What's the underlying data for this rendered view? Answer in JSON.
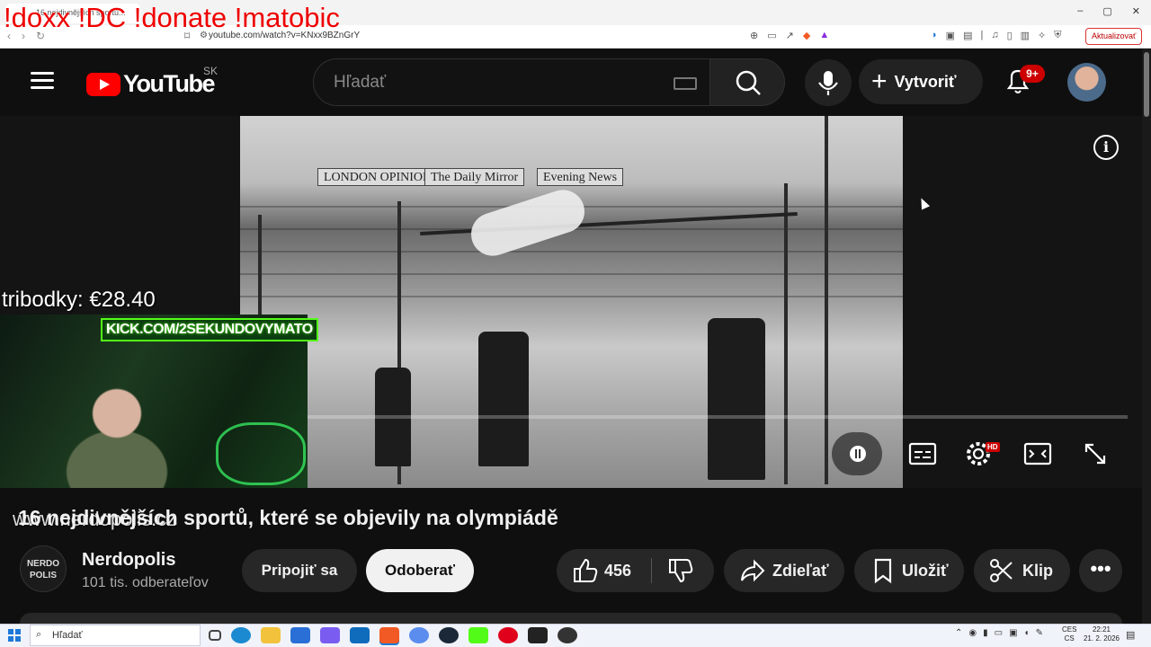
{
  "browser": {
    "tab_title": "16 nejdivnějších sportů...",
    "url": "youtube.com/watch?v=KNxx9BZnGrY",
    "update_button": "Aktualizovať",
    "window_controls": [
      "–",
      "▢",
      "✕"
    ]
  },
  "stream_overlay": {
    "commands": "!doxx !DC  !donate  !matobic",
    "donation_text": "tribodky: €28.40",
    "kick_banner": "KICK.COM/2SEKUNDOVYMATO",
    "ticker_text": "www.nerdopolis.cz"
  },
  "youtube": {
    "logo_text": "YouTube",
    "region": "SK",
    "search_placeholder": "Hľadať",
    "create_label": "Vytvoriť",
    "notification_count": "9+",
    "video_banners": [
      "LONDON OPINION",
      "The Daily Mirror",
      "Evening News"
    ],
    "hd_badge": "HD",
    "video_title": "16 nejdivnějších sportů, které se objevily na olympiádě",
    "channel": {
      "avatar_text": "NERDO POLIS",
      "name": "Nerdopolis",
      "subscribers": "101 tis. odberateľov"
    },
    "actions": {
      "join": "Pripojiť sa",
      "subscribe": "Odoberať",
      "like_count": "456",
      "share": "Zdieľať",
      "save": "Uložiť",
      "clip": "Klip",
      "more": "•••"
    }
  },
  "taskbar": {
    "search_placeholder": "Hľadať",
    "language": "CES\nCS",
    "time": "22:21",
    "date": "21. 2. 2026"
  },
  "colors": {
    "brand_red": "#ff0000",
    "overlay_red": "#e00000",
    "kick_green": "#53fc18",
    "background": "#0f0f0f"
  }
}
